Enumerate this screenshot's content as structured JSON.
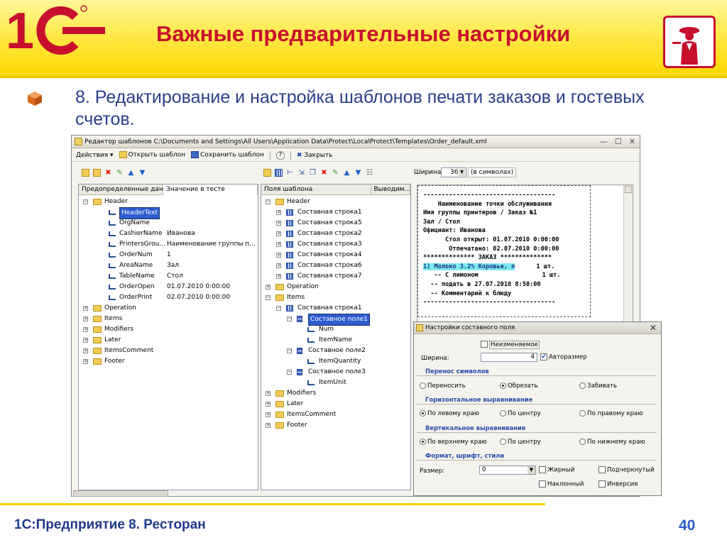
{
  "slide": {
    "title": "Важные предварительные настройки",
    "subtitle": "8. Редактирование и настройка шаблонов печати заказов и гостевых счетов.",
    "footer": "1С:Предприятие 8. Ресторан",
    "page_number": "40",
    "logo_text": "1С",
    "colors": {
      "brand_red": "#c8102e",
      "brand_yellow": "#ffe94a",
      "text_blue": "#2a3f8a"
    }
  },
  "window": {
    "title": "Редактор шаблонов  C:\\Documents and Settings\\All Users\\Application Data\\Protect\\LocalProtect\\Templates\\Order_default.xml",
    "menu": {
      "actions": "Действия ▾",
      "open": "Открыть шаблон",
      "save": "Сохранить шаблон",
      "help": "?",
      "close": "Закрыть"
    },
    "width_label": "Ширина:",
    "width_value": "36",
    "width_units": "(в символах)",
    "left_panel": {
      "col1": "Предопределенные данные",
      "col2": "Значение в тесте",
      "rows": [
        {
          "label": "Header",
          "value": ""
        },
        {
          "label": "HeaderText",
          "value": ""
        },
        {
          "label": "OrgName",
          "value": ""
        },
        {
          "label": "CashierName",
          "value": "Иванова"
        },
        {
          "label": "PrintersGrou...",
          "value": "Наименование группы п..."
        },
        {
          "label": "OrderNum",
          "value": "1"
        },
        {
          "label": "AreaName",
          "value": "Зал"
        },
        {
          "label": "TableName",
          "value": "Стол"
        },
        {
          "label": "OrderOpen",
          "value": "01.07.2010 0:00:00"
        },
        {
          "label": "OrderPrint",
          "value": "02.07.2010 0:00:00"
        },
        {
          "label": "Operation",
          "value": ""
        },
        {
          "label": "Items",
          "value": ""
        },
        {
          "label": "Modifiers",
          "value": ""
        },
        {
          "label": "Later",
          "value": ""
        },
        {
          "label": "ItemsComment",
          "value": ""
        },
        {
          "label": "Footer",
          "value": ""
        }
      ]
    },
    "middle_panel": {
      "col1": "Поля шаблона",
      "col2": "Выводим...",
      "rows": [
        "Header",
        "Составная строка1",
        "Составная строка5",
        "Составная строка2",
        "Составная строка3",
        "Составная строка4",
        "Составная строка6",
        "Составная строка7",
        "Operation",
        "Items",
        "Составная строка1",
        "Составное поле1",
        "Num",
        "ItemName",
        "Составное поле2",
        "ItemQuantity",
        "Составное поле3",
        "ItemUnit",
        "Modifiers",
        "Later",
        "ItemsComment",
        "Footer"
      ]
    },
    "preview_lines": [
      "------------------------------------",
      "    Наименование точки обслуживания",
      "Имя группы принтеров / Заказ №1",
      "Зал / Стол",
      "Официант: Иванова",
      "      Стол открыт: 01.07.2010 0:00:00",
      "       Отпечатано: 02.07.2010 0:00:00",
      "************** ЗАКАЗ **************",
      "1) Молоко 3.2% Коровье, п",
      "   -- С лимоном",
      "  -- подать в 27.07.2010 8:50:00",
      "  -- Комментарий к блюду",
      "------------------------------------"
    ],
    "preview_qty1": "1 шт.",
    "preview_qty2": "1 шт."
  },
  "dialog": {
    "title": "Настройки составного поля",
    "unchangeable": "Неизменяемое",
    "width_label": "Ширина:",
    "width_value": "4",
    "autosize": "Авторазмер",
    "wrap_section": "Перенос символов",
    "wrap_opts": [
      "Переносить",
      "Обрезать",
      "Забивать"
    ],
    "halign_section": "Горизонтальное выравнивание",
    "halign_opts": [
      "По левому краю",
      "По центру",
      "По правому краю"
    ],
    "valign_section": "Вертикальное выравнивание",
    "valign_opts": [
      "По верхнему краю",
      "По центру",
      "По нижнему краю"
    ],
    "font_section": "Формат, шрифт, стили",
    "size_label": "Размер:",
    "size_value": "0",
    "bold": "Жирный",
    "underline": "Подчеркнутый",
    "italic": "Наклонный",
    "inverse": "Инверсия"
  }
}
